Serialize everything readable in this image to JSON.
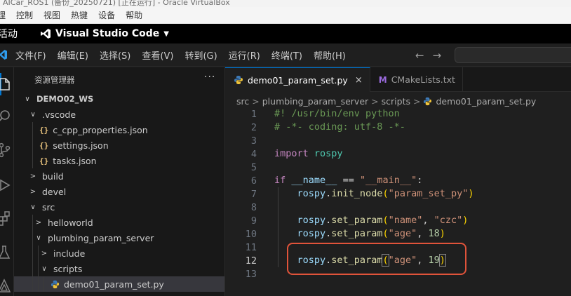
{
  "vbox": {
    "title": "AICar_ROS1 (备份_20250721) [正在运行] - Oracle VirtualBox",
    "menu": [
      "理",
      "控制",
      "视图",
      "热键",
      "设备",
      "帮助"
    ]
  },
  "gnome": {
    "activities": "活动",
    "app_name": "Visual Studio Code",
    "app_caret": "▼"
  },
  "vscode_menu": {
    "items": [
      "文件(F)",
      "编辑(E)",
      "选择(S)",
      "查看(V)",
      "转到(G)",
      "运行(R)",
      "终端(T)",
      "帮助(H)"
    ],
    "back": "←",
    "forward": "→"
  },
  "activity_bar": {
    "icons": [
      "explorer-icon",
      "search-icon",
      "source-control-icon",
      "run-debug-icon",
      "extensions-icon",
      "testing-icon",
      "ros-icon"
    ]
  },
  "sidebar": {
    "title": "资源管理器",
    "more": "···",
    "tree": [
      {
        "label": "DEMO02_WS",
        "depth": 0,
        "chevron": "∨",
        "type": "root"
      },
      {
        "label": ".vscode",
        "depth": 1,
        "chevron": "∨",
        "type": "folder"
      },
      {
        "label": "c_cpp_properties.json",
        "depth": 2,
        "chevron": "",
        "type": "json"
      },
      {
        "label": "settings.json",
        "depth": 2,
        "chevron": "",
        "type": "json"
      },
      {
        "label": "tasks.json",
        "depth": 2,
        "chevron": "",
        "type": "json"
      },
      {
        "label": "build",
        "depth": 1,
        "chevron": ">",
        "type": "folder"
      },
      {
        "label": "devel",
        "depth": 1,
        "chevron": ">",
        "type": "folder"
      },
      {
        "label": "src",
        "depth": 1,
        "chevron": "∨",
        "type": "folder"
      },
      {
        "label": "helloworld",
        "depth": 2,
        "chevron": ">",
        "type": "folder"
      },
      {
        "label": "plumbing_param_server",
        "depth": 2,
        "chevron": "∨",
        "type": "folder"
      },
      {
        "label": "include",
        "depth": 3,
        "chevron": ">",
        "type": "folder"
      },
      {
        "label": "scripts",
        "depth": 3,
        "chevron": "∨",
        "type": "folder"
      },
      {
        "label": "demo01_param_set.py",
        "depth": 4,
        "chevron": "",
        "type": "python",
        "selected": true
      }
    ],
    "json_glyph": "{}"
  },
  "editor": {
    "tabs": [
      {
        "label": "demo01_param_set.py",
        "active": true,
        "close": "×"
      },
      {
        "label": "CMakeLists.txt",
        "active": false,
        "icon_text": "M"
      }
    ],
    "breadcrumb": [
      "src",
      "plumbing_param_server",
      "scripts",
      "demo01_param_set.py"
    ],
    "breadcrumb_sep": ">",
    "current_line": 12,
    "lines": [
      {
        "n": "1",
        "tokens": [
          {
            "t": "#! /usr/bin/env python",
            "c": "cmt"
          }
        ]
      },
      {
        "n": "2",
        "tokens": [
          {
            "t": "# -*- coding: utf-8 -*-",
            "c": "cmt"
          }
        ]
      },
      {
        "n": "3",
        "tokens": []
      },
      {
        "n": "4",
        "tokens": [
          {
            "t": "import",
            "c": "kw"
          },
          {
            "t": " ",
            "c": "pl"
          },
          {
            "t": "rospy",
            "c": "mod"
          }
        ]
      },
      {
        "n": "5",
        "tokens": []
      },
      {
        "n": "6",
        "tokens": [
          {
            "t": "if",
            "c": "kw"
          },
          {
            "t": " ",
            "c": "pl"
          },
          {
            "t": "__name__",
            "c": "var"
          },
          {
            "t": " == ",
            "c": "pl"
          },
          {
            "t": "\"__main__\"",
            "c": "str"
          },
          {
            "t": ":",
            "c": "pl"
          }
        ]
      },
      {
        "n": "7",
        "indent": true,
        "tokens": [
          {
            "t": "    rospy",
            "c": "var"
          },
          {
            "t": ".",
            "c": "pl"
          },
          {
            "t": "init_node",
            "c": "fn"
          },
          {
            "t": "(",
            "c": "bracket"
          },
          {
            "t": "\"param_set_py\"",
            "c": "str"
          },
          {
            "t": ")",
            "c": "bracket"
          }
        ]
      },
      {
        "n": "8",
        "indent": true,
        "tokens": []
      },
      {
        "n": "9",
        "indent": true,
        "tokens": [
          {
            "t": "    rospy",
            "c": "var"
          },
          {
            "t": ".",
            "c": "pl"
          },
          {
            "t": "set_param",
            "c": "fn"
          },
          {
            "t": "(",
            "c": "bracket"
          },
          {
            "t": "\"name\"",
            "c": "str"
          },
          {
            "t": ", ",
            "c": "pl"
          },
          {
            "t": "\"czc\"",
            "c": "str"
          },
          {
            "t": ")",
            "c": "bracket"
          }
        ]
      },
      {
        "n": "10",
        "indent": true,
        "tokens": [
          {
            "t": "    rospy",
            "c": "var"
          },
          {
            "t": ".",
            "c": "pl"
          },
          {
            "t": "set_param",
            "c": "fn"
          },
          {
            "t": "(",
            "c": "bracket"
          },
          {
            "t": "\"age\"",
            "c": "str"
          },
          {
            "t": ", ",
            "c": "pl"
          },
          {
            "t": "18",
            "c": "num"
          },
          {
            "t": ")",
            "c": "bracket"
          }
        ]
      },
      {
        "n": "11",
        "indent": true,
        "tokens": []
      },
      {
        "n": "12",
        "indent": true,
        "tokens": [
          {
            "t": "    rospy",
            "c": "var"
          },
          {
            "t": ".",
            "c": "pl"
          },
          {
            "t": "set_param",
            "c": "fn"
          },
          {
            "t": "(",
            "c": "bracket box"
          },
          {
            "t": "\"age\"",
            "c": "str"
          },
          {
            "t": ", ",
            "c": "pl"
          },
          {
            "t": "19",
            "c": "num"
          },
          {
            "t": ")",
            "c": "bracket box"
          }
        ]
      },
      {
        "n": "13",
        "tokens": []
      }
    ]
  },
  "colors": {
    "accent": "#0078d4",
    "annotation_box": "#e0533a"
  }
}
